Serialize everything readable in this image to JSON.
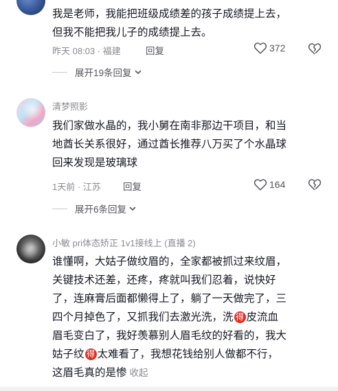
{
  "comments": [
    {
      "content_lines": [
        "我是老师，我能把班级成绩差的孩子成绩提上去，",
        "但我不能把我儿子的成绩提上去。"
      ],
      "meta": "昨天 08:03 · 福建",
      "reply_label": "回复",
      "like_count": "372",
      "expand_label": "展开19条回复"
    },
    {
      "username": "清梦照影",
      "content_lines": [
        "我们家做水晶的，我小舅在南非那边干项目，和当",
        "地酋长关系很好，通过酋长推荐八万买了个水晶球",
        "回来发现是玻璃球"
      ],
      "meta": "1天前 · 江苏",
      "reply_label": "回复",
      "like_count": "164",
      "expand_label": "展开6条回复"
    },
    {
      "username": "小敏 pri体态矫正 1v1接线上 (直播 2)",
      "line1": "谁懂啊，大姑子做纹眉的，全家都被抓过来纹眉，",
      "line2": "关键技术还差，还疼，疼就叫我们忍着，说快好",
      "line3": "了，连麻膏后面都懒得上了，躺了一天做完了，三",
      "line4a": "四个月掉色了，又抓我们去激光洗，洗",
      "badge": "得",
      "line4b": "皮流血",
      "line5": "眉毛变白了，我好羡慕别人眉毛纹的好看的，我大",
      "line6a": "姑子纹",
      "line6b": "太难看了，我想花钱给别人做都不行，",
      "line7": "这眉毛真的是惨",
      "collapse_label": "收起"
    }
  ],
  "colors": {
    "text": "#161823",
    "meta": "#8a8b91",
    "badge": "#e02e24"
  },
  "icons": [
    "heart-outline-icon",
    "broken-heart-icon",
    "chevron-down-icon"
  ]
}
